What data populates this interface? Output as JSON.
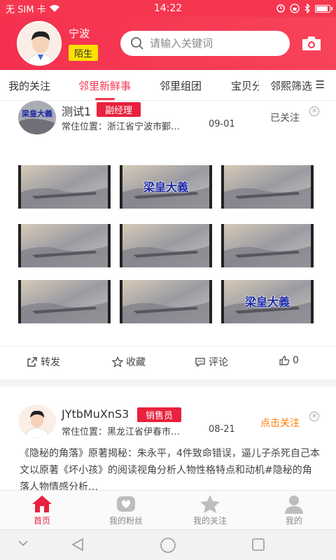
{
  "status_bar": {
    "carrier": "无 SIM 卡",
    "time": "14:22",
    "battery_pct": 0.8
  },
  "header": {
    "user_name": "宁波",
    "user_role": "陌生",
    "search_placeholder": "请输入关键词"
  },
  "tabs": [
    {
      "label": "我的关注",
      "active": false
    },
    {
      "label": "邻里新鲜事",
      "active": true
    },
    {
      "label": "邻里组团",
      "active": false
    },
    {
      "label": "宝贝分",
      "active": false
    },
    {
      "label": "邻熙筛选",
      "active": false
    }
  ],
  "tabs_menu_icon": "menu-icon",
  "posts": [
    {
      "name": "测试1",
      "badge": "副经理",
      "location": "常住位置：浙江省宁波市鄞…",
      "date": "09-01",
      "follow_status": "已关注",
      "watermark": "梁皇大義",
      "actions": {
        "share": "转发",
        "favorite": "收藏",
        "comment": "评论",
        "like_count": "0"
      }
    },
    {
      "name": "JYtbMuXnS3",
      "badge": "销售员",
      "location": "常住位置：黑龙江省伊春市…",
      "date": "08-21",
      "follow_status": "点击关注",
      "text": "《隐秘的角落》原著揭秘：朱永平，4件致命错误，逼儿子杀死自己本文以原著《坏小孩》的阅读视角分析人物性格特点和动机#隐秘的角落人物情感分析…"
    }
  ],
  "bottom_nav": [
    {
      "label": "首页",
      "icon": "home-icon",
      "active": true
    },
    {
      "label": "我的粉丝",
      "icon": "fans-icon",
      "active": false
    },
    {
      "label": "我的关注",
      "icon": "star-icon",
      "active": false
    },
    {
      "label": "我的",
      "icon": "profile-icon",
      "active": false
    }
  ],
  "colors": {
    "brand": "#f5364f",
    "badge_red": "#e8223e",
    "role_yellow": "#ffe000",
    "follow_orange": "#ff7a00"
  }
}
